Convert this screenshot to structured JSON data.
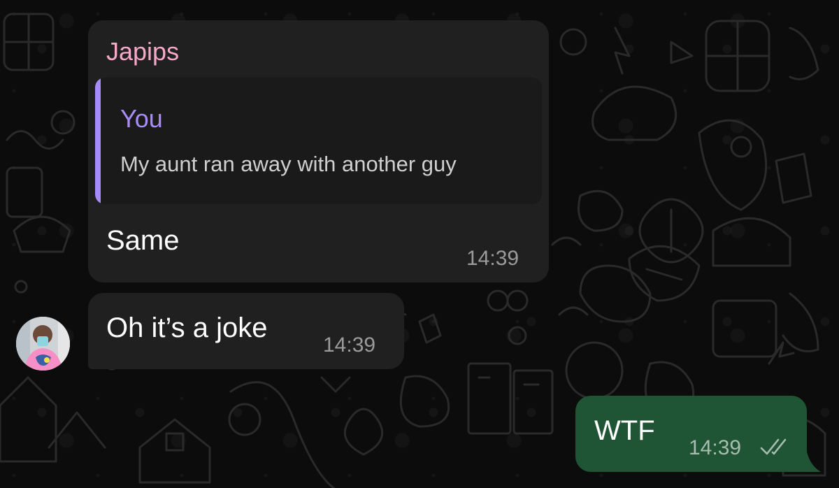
{
  "messages": [
    {
      "sender": "Japips",
      "reply": {
        "author": "You",
        "text": "My aunt ran away with another guy"
      },
      "text": "Same",
      "time": "14:39"
    },
    {
      "text": "Oh it’s a joke",
      "time": "14:39"
    },
    {
      "text": "WTF",
      "time": "14:39",
      "status": "read-double-check-icon"
    }
  ],
  "colors": {
    "background": "#0c0c0c",
    "incoming_bubble": "#202020",
    "outgoing_bubble": "#1f5535",
    "sender_name": "#f7a8c9",
    "reply_author": "#a98cf6",
    "reply_bar": "#a78bfa",
    "timestamp": "#9b9b9b"
  }
}
